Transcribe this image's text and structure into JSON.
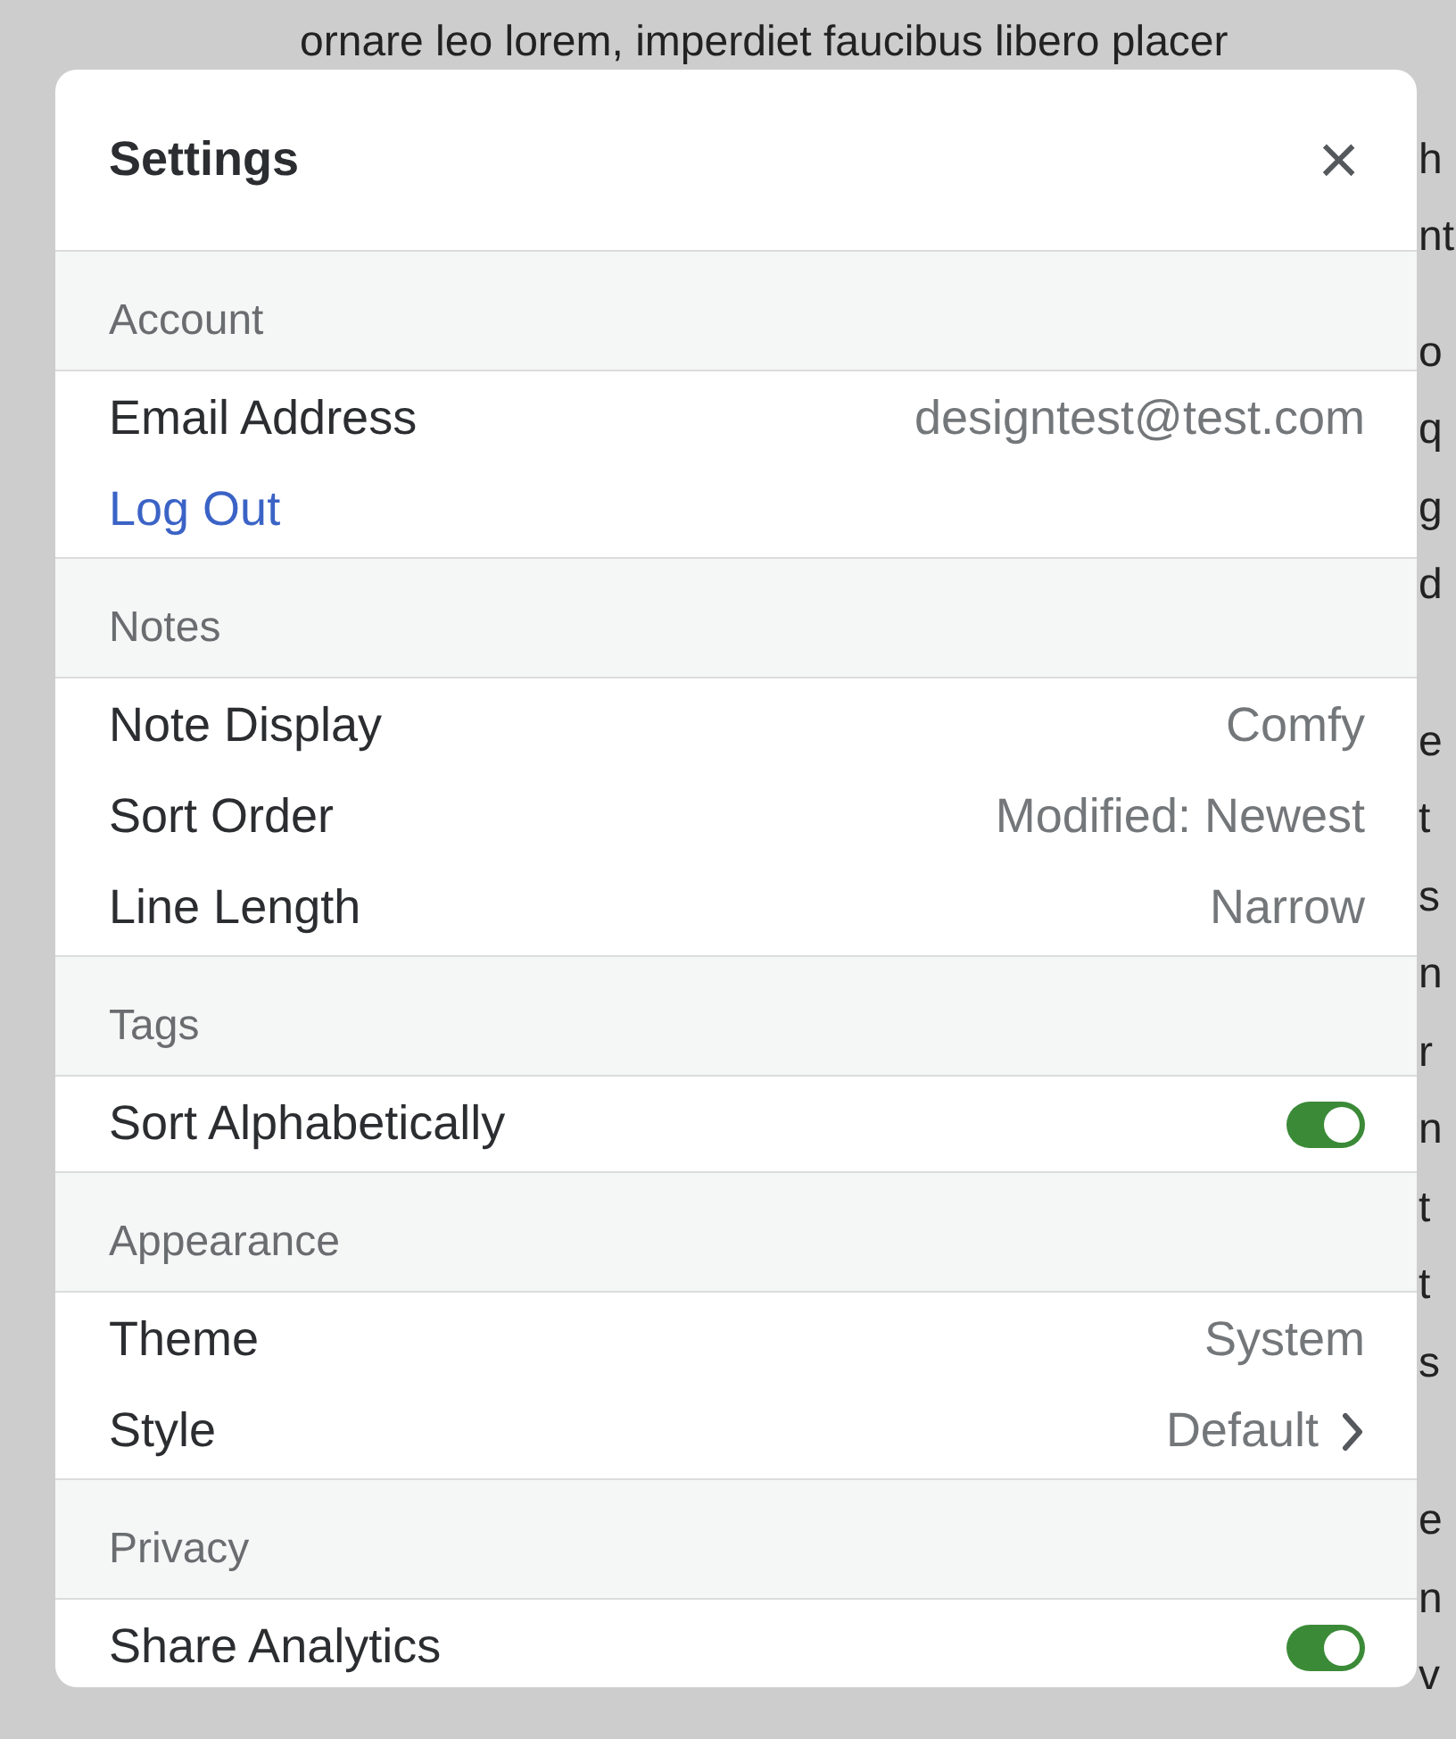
{
  "background_text": {
    "paragraphs": [
      {
        "lines": [
          "ornare leo lorem, imperdiet faucibus libero placer",
          "h",
          "nt"
        ]
      },
      {
        "lines": [
          "o",
          "q",
          "g",
          "d"
        ]
      },
      {
        "lines": [
          "e",
          "t",
          "s",
          "n",
          "r",
          "n",
          "t",
          "t",
          "s"
        ]
      },
      {
        "lines": [
          "e",
          "n",
          "v"
        ]
      }
    ]
  },
  "dialog": {
    "title": "Settings",
    "close": "×",
    "sections": [
      {
        "title": "Account",
        "rows": [
          {
            "kind": "value",
            "label": "Email Address",
            "value": "designtest@test.com"
          },
          {
            "kind": "link",
            "label": "Log Out"
          }
        ]
      },
      {
        "title": "Notes",
        "rows": [
          {
            "kind": "value",
            "label": "Note Display",
            "value": "Comfy"
          },
          {
            "kind": "value",
            "label": "Sort Order",
            "value": "Modified: Newest"
          },
          {
            "kind": "value",
            "label": "Line Length",
            "value": "Narrow"
          }
        ]
      },
      {
        "title": "Tags",
        "rows": [
          {
            "kind": "toggle",
            "label": "Sort Alphabetically",
            "on": true
          }
        ]
      },
      {
        "title": "Appearance",
        "rows": [
          {
            "kind": "value",
            "label": "Theme",
            "value": "System"
          },
          {
            "kind": "nav",
            "label": "Style",
            "value": "Default"
          }
        ]
      },
      {
        "title": "Privacy",
        "rows": [
          {
            "kind": "toggle",
            "label": "Share Analytics",
            "on": true
          }
        ]
      }
    ]
  }
}
